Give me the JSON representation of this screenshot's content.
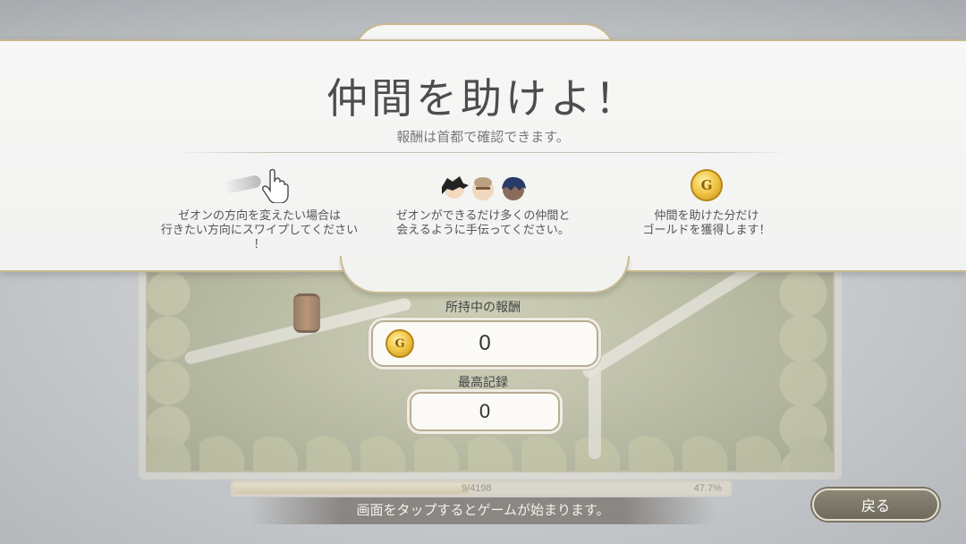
{
  "banner": {
    "title": "仲間を助けよ！",
    "subtitle": "報酬は首都で確認できます。",
    "hints": [
      {
        "icon": "swipe-hand-icon",
        "lines": [
          "ゼオンの方向を変えたい場合は",
          "行きたい方向にスワイプしてください",
          "！"
        ]
      },
      {
        "icon": "party-characters-icon",
        "lines": [
          "ゼオンができるだけ多くの仲間と",
          "会えるように手伝ってください。"
        ]
      },
      {
        "icon": "gold-coin-icon",
        "coin_letter": "G",
        "lines": [
          "仲間を助けた分だけ",
          "ゴールドを獲得します！"
        ]
      }
    ]
  },
  "reward": {
    "label": "所持中の報酬",
    "coin_letter": "G",
    "value": "0"
  },
  "best": {
    "label": "最高記録",
    "value": "0"
  },
  "progress": {
    "count": "9/4198",
    "percent_text": "47.7%",
    "fraction": 0.477
  },
  "footer": {
    "tap_text": "画面をタップするとゲームが始まります。",
    "back_label": "戻る"
  },
  "colors": {
    "gold": "#f2c84a",
    "frame": "#c8b98f",
    "back_button": "#7a7466"
  }
}
